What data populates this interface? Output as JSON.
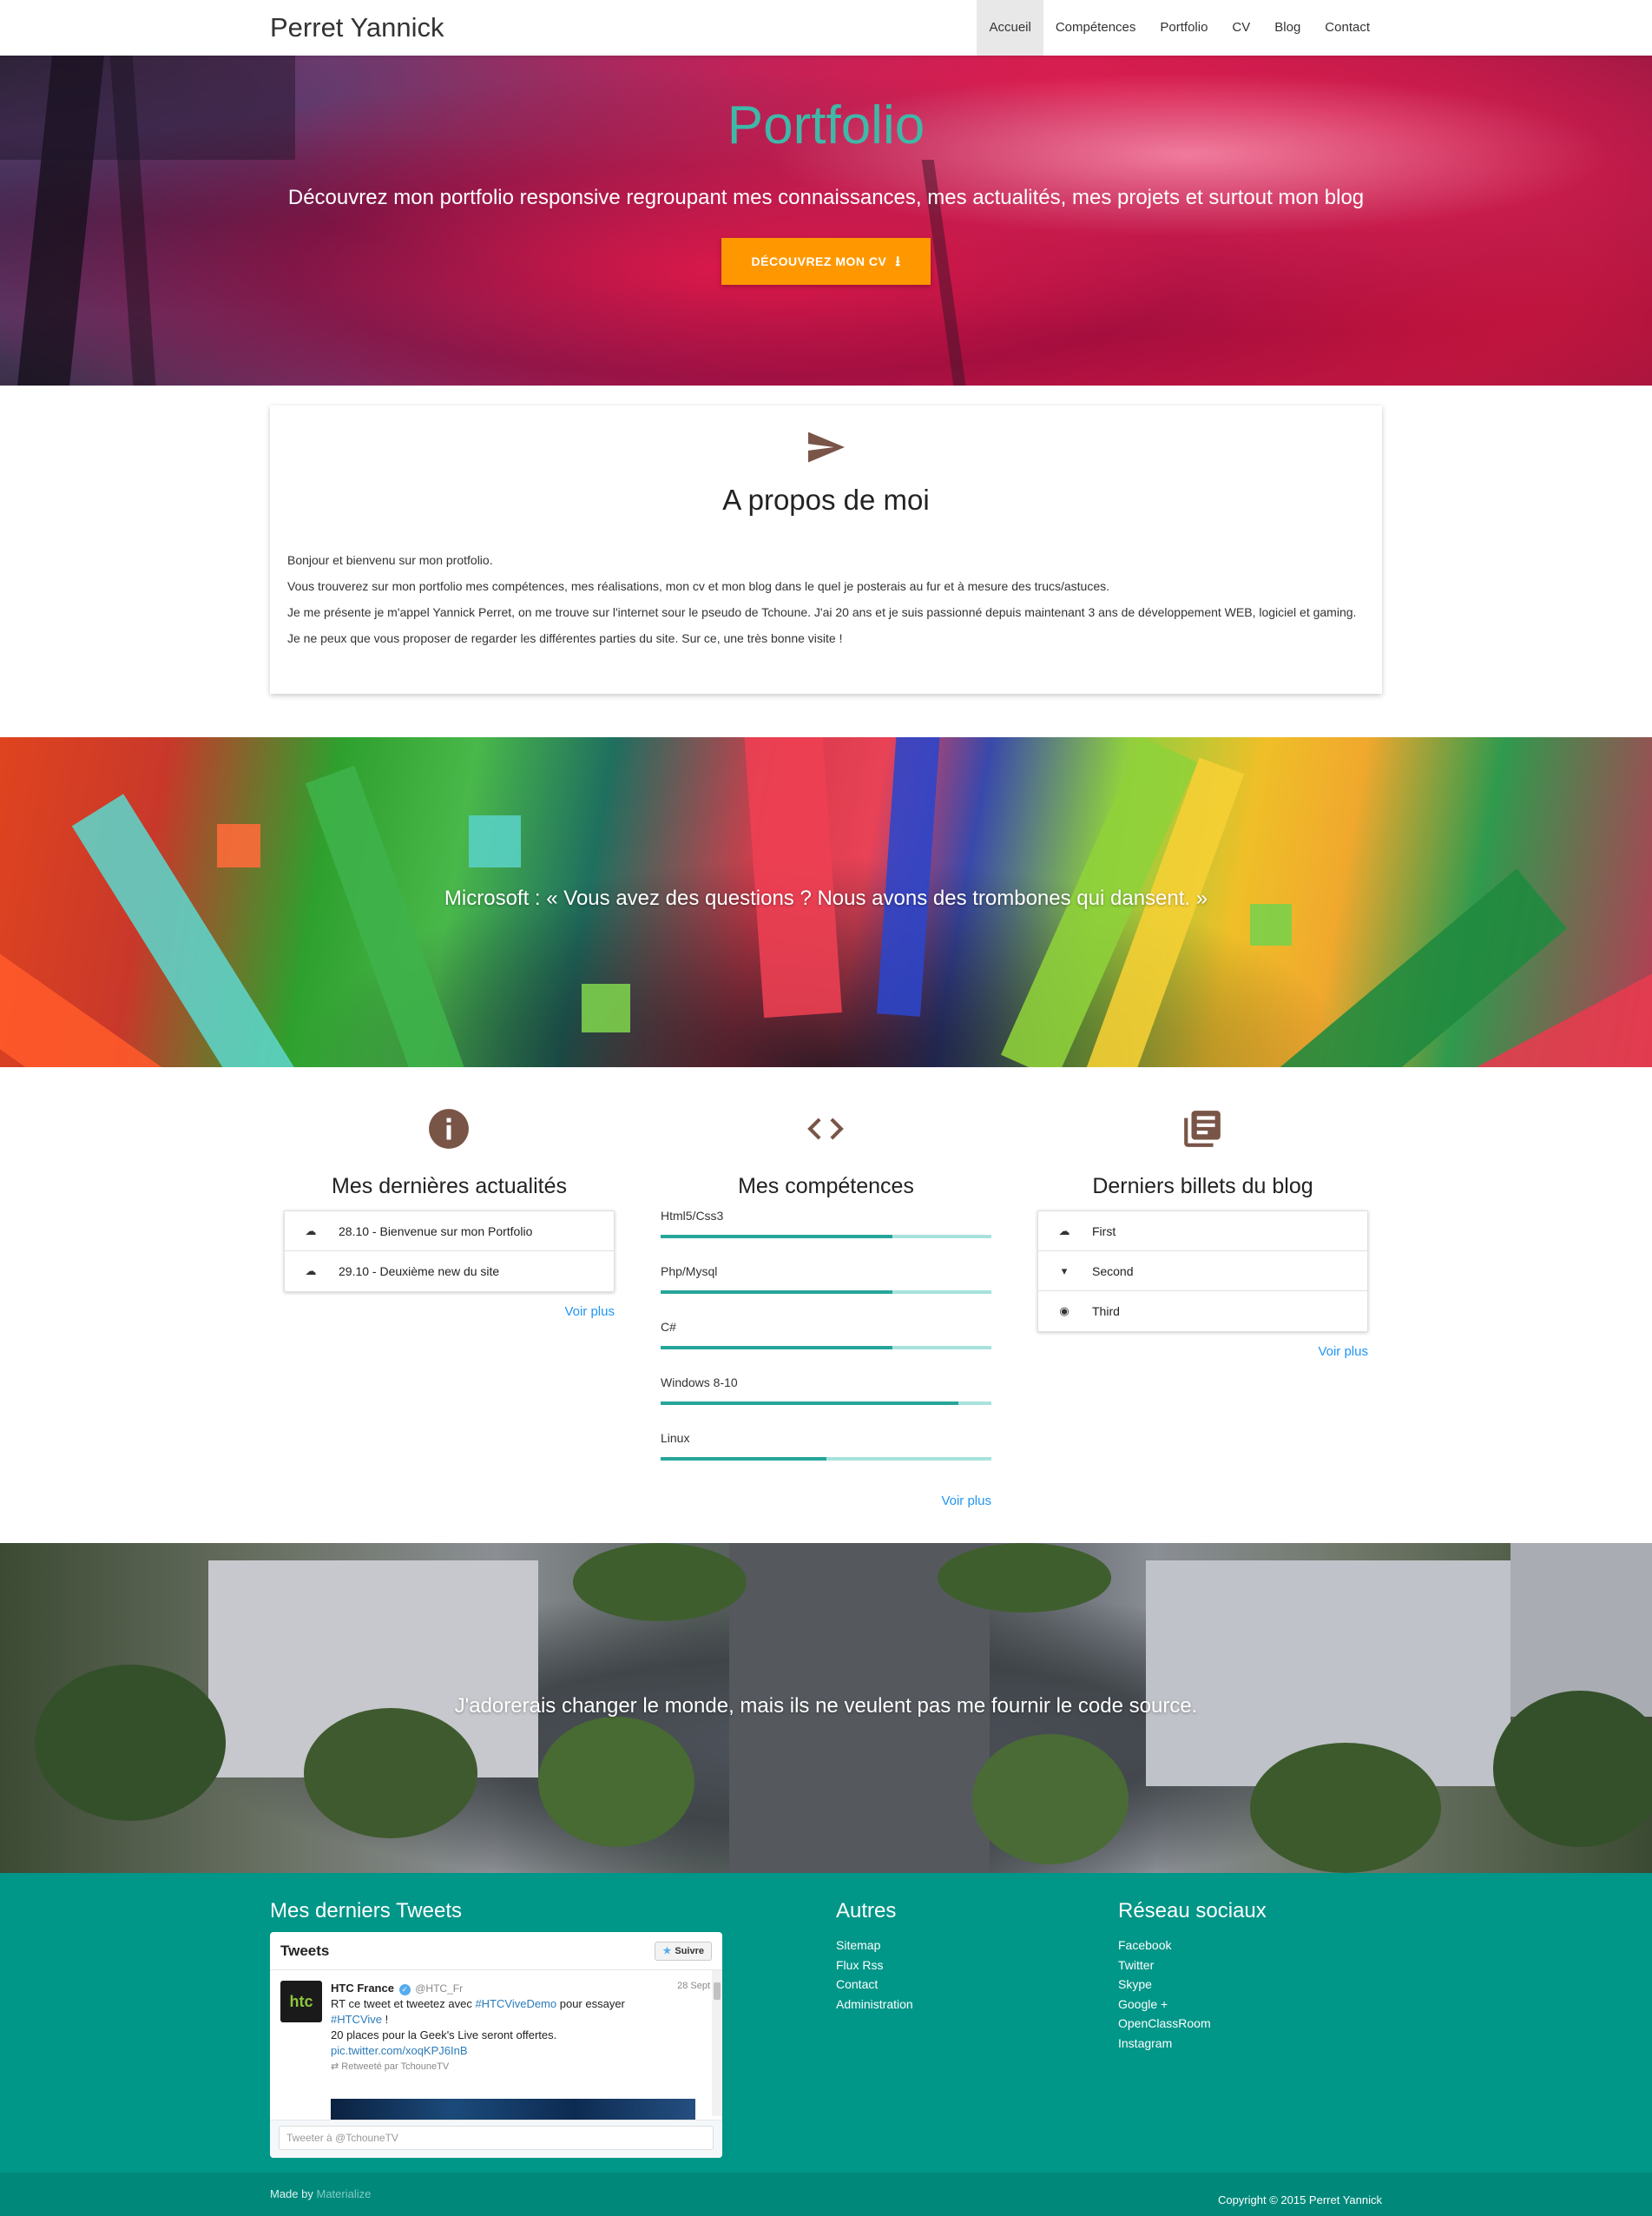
{
  "navbar": {
    "brand": "Perret Yannick",
    "links": [
      "Accueil",
      "Compétences",
      "Portfolio",
      "CV",
      "Blog",
      "Contact"
    ],
    "active": "Accueil"
  },
  "hero": {
    "title": "Portfolio",
    "subtitle": "Découvrez mon portfolio responsive regroupant mes connaissances, mes actualités, mes projets et surtout mon blog",
    "button_label": "DÉCOUVREZ MON CV",
    "button_icon": "download-icon"
  },
  "about": {
    "icon": "send-icon",
    "title": "A propos de moi",
    "lines": [
      "Bonjour et bienvenu sur mon protfolio.",
      "Vous trouverez sur mon portfolio mes compétences, mes réalisations, mon cv et mon blog dans le quel je posterais au fur et à mesure des trucs/astuces.",
      "Je me présente je m'appel Yannick Perret, on me trouve sur l'internet sour le pseudo de Tchoune. J'ai 20 ans et je suis passionné depuis maintenant 3 ans de développement WEB, logiciel et gaming.",
      "Je ne peux que vous proposer de regarder les différentes parties du site. Sur ce, une très bonne visite !"
    ]
  },
  "quote1": "Microsoft : « Vous avez des questions ? Nous avons des trombones qui dansent. »",
  "news": {
    "icon": "info-icon",
    "title": "Mes dernières actualités",
    "items": [
      {
        "icon": "cloud-icon",
        "label": "28.10 - Bienvenue sur mon Portfolio"
      },
      {
        "icon": "cloud-icon",
        "label": "29.10 - Deuxième new du site"
      }
    ],
    "more": "Voir plus"
  },
  "skills": {
    "icon": "code-icon",
    "title": "Mes compétences",
    "items": [
      {
        "label": "Html5/Css3",
        "level": 0.7
      },
      {
        "label": "Php/Mysql",
        "level": 0.7
      },
      {
        "label": "C#",
        "level": 0.7
      },
      {
        "label": "Windows 8-10",
        "level": 0.9
      },
      {
        "label": "Linux",
        "level": 0.5
      }
    ],
    "more": "Voir plus"
  },
  "blog": {
    "icon": "library-books-icon",
    "title": "Derniers billets du blog",
    "items": [
      {
        "icon": "cloud-icon",
        "label": "First"
      },
      {
        "icon": "pin-icon",
        "label": "Second"
      },
      {
        "icon": "fire-icon",
        "label": "Third"
      }
    ],
    "more": "Voir plus"
  },
  "quote2": "J'adorerais changer le monde, mais ils ne veulent pas me fournir le code source.",
  "footer": {
    "tweets_title": "Mes derniers Tweets",
    "widget": {
      "header": "Tweets",
      "follow": "Suivre",
      "tweet": {
        "avatar_text": "htc",
        "name": "HTC France",
        "handle": "@HTC_Fr",
        "date": "28 Sept",
        "text_prefix": "RT ce tweet et tweetez avec ",
        "hashtag1": "#HTCViveDemo",
        "text_mid": " pour essayer ",
        "hashtag2": "#HTCVive",
        "text_after": " !",
        "line2": "20 places pour la Geek's Live seront offertes.",
        "link": "pic.twitter.com/xoqKPJ6InB",
        "retweeted_by": "Retweeté par TchouneTV"
      },
      "input_placeholder": "Tweeter à @TchouneTV"
    },
    "others_title": "Autres",
    "others": [
      "Sitemap",
      "Flux Rss",
      "Contact",
      "Administration"
    ],
    "social_title": "Réseau sociaux",
    "social": [
      "Facebook",
      "Twitter",
      "Skype",
      "Google +",
      "OpenClassRoom",
      "Instagram"
    ],
    "made_by_prefix": "Made by ",
    "made_by_link": "Materialize",
    "copyright": "Copyright © 2015 Perret Yannick"
  },
  "colors": {
    "accent": "#009688",
    "accent_dark": "#00897b",
    "hero_title": "#3fb8a8",
    "button": "#ff9800",
    "icon_brown": "#795548",
    "link": "#2196f3",
    "skill_fill": "#26a69a",
    "skill_track": "#a7e2dc"
  }
}
